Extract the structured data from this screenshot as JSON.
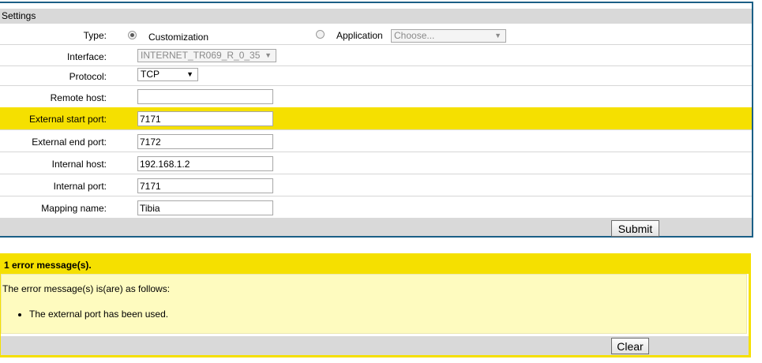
{
  "settings": {
    "title": "Settings",
    "type": {
      "label": "Type:",
      "option_customization": "Customization",
      "option_application": "Application",
      "application_select_placeholder": "Choose..."
    },
    "interface": {
      "label": "Interface:",
      "value": "INTERNET_TR069_R_0_35"
    },
    "protocol": {
      "label": "Protocol:",
      "value": "TCP"
    },
    "remote_host": {
      "label": "Remote host:",
      "value": ""
    },
    "external_start_port": {
      "label": "External start port:",
      "value": "7171"
    },
    "external_end_port": {
      "label": "External end port:",
      "value": "7172"
    },
    "internal_host": {
      "label": "Internal host:",
      "value": "192.168.1.2"
    },
    "internal_port": {
      "label": "Internal port:",
      "value": "7171"
    },
    "mapping_name": {
      "label": "Mapping name:",
      "value": "Tibia"
    },
    "submit_label": "Submit"
  },
  "error": {
    "title": "1 error message(s).",
    "intro": "The error message(s) is(are) as follows:",
    "messages": [
      "The external port has been used."
    ],
    "clear_label": "Clear"
  },
  "colors": {
    "highlight": "#f5e000",
    "panel_border": "#1b5f86",
    "error_body": "#fefbbf",
    "bar_gray": "#d9d9d9"
  }
}
